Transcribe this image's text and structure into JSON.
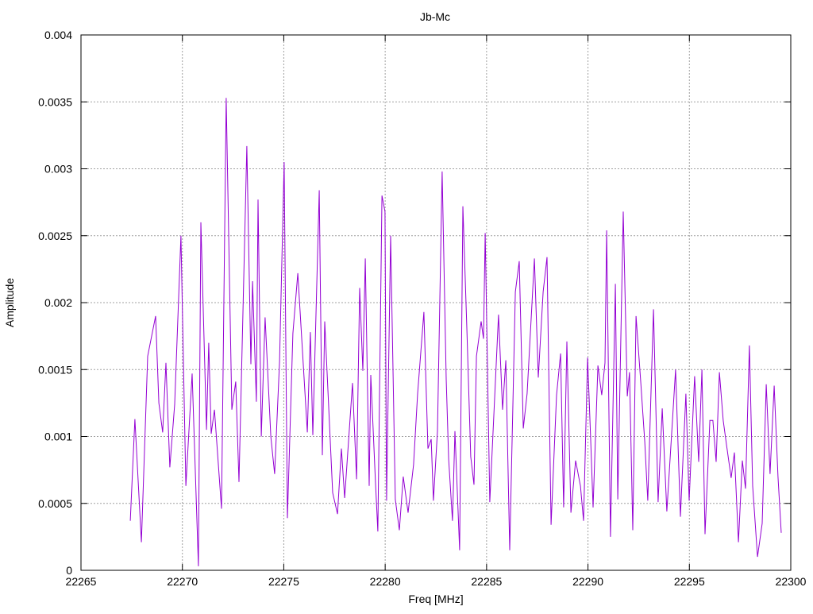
{
  "chart_data": {
    "type": "line",
    "title": "Jb-Mc",
    "xlabel": "Freq [MHz]",
    "ylabel": "Amplitude",
    "xlim": [
      22265,
      22300
    ],
    "ylim": [
      0,
      0.004
    ],
    "xticks": [
      "22265",
      "22270",
      "22275",
      "22280",
      "22285",
      "22290",
      "22295",
      "22300"
    ],
    "yticks": [
      "0",
      "0.0005",
      "0.001",
      "0.0015",
      "0.002",
      "0.0025",
      "0.003",
      "0.0035",
      "0.004"
    ],
    "grid": true,
    "legend": "none",
    "series": [
      {
        "name": "Jb-Mc",
        "color": "#9400d3",
        "x": [
          22267.43,
          22267.66,
          22267.98,
          22268.29,
          22268.68,
          22268.84,
          22269.03,
          22269.19,
          22269.38,
          22269.62,
          22269.93,
          22270.17,
          22270.48,
          22270.79,
          22270.91,
          22271.19,
          22271.3,
          22271.42,
          22271.58,
          22271.93,
          22272.16,
          22272.44,
          22272.63,
          22272.79,
          22273.18,
          22273.38,
          22273.46,
          22273.65,
          22273.73,
          22273.89,
          22274.08,
          22274.36,
          22274.55,
          22274.79,
          22275.02,
          22275.18,
          22275.45,
          22275.69,
          22276.16,
          22276.31,
          22276.43,
          22276.75,
          22276.9,
          22277.02,
          22277.41,
          22277.65,
          22277.84,
          22278.0,
          22278.39,
          22278.59,
          22278.74,
          22278.9,
          22279.02,
          22279.21,
          22279.29,
          22279.52,
          22279.64,
          22279.84,
          22279.99,
          22280.07,
          22280.27,
          22280.5,
          22280.7,
          22280.89,
          22281.13,
          22281.4,
          22281.6,
          22281.91,
          22282.11,
          22282.27,
          22282.38,
          22282.58,
          22282.81,
          22283.01,
          22283.13,
          22283.32,
          22283.44,
          22283.67,
          22283.83,
          22284.03,
          22284.22,
          22284.38,
          22284.5,
          22284.73,
          22284.85,
          22284.93,
          22285.16,
          22285.59,
          22285.79,
          22285.95,
          22286.14,
          22286.42,
          22286.61,
          22286.81,
          22287.0,
          22287.24,
          22287.36,
          22287.55,
          22287.79,
          22287.98,
          22288.18,
          22288.45,
          22288.65,
          22288.8,
          22288.96,
          22289.16,
          22289.39,
          22289.63,
          22289.78,
          22289.98,
          22290.13,
          22290.25,
          22290.49,
          22290.68,
          22290.84,
          22290.92,
          22291.11,
          22291.35,
          22291.47,
          22291.74,
          22291.94,
          22292.05,
          22292.21,
          22292.37,
          22292.6,
          22292.8,
          22292.95,
          22293.23,
          22293.46,
          22293.66,
          22293.89,
          22294.17,
          22294.32,
          22294.56,
          22294.83,
          22294.99,
          22295.26,
          22295.46,
          22295.62,
          22295.77,
          22296.01,
          22296.16,
          22296.32,
          22296.48,
          22296.67,
          22296.83,
          22297.06,
          22297.22,
          22297.42,
          22297.61,
          22297.77,
          22297.96,
          22298.12,
          22298.36,
          22298.59,
          22298.79,
          22298.98,
          22299.18,
          22299.37,
          22299.53
        ],
        "y": [
          0.00037,
          0.00113,
          0.00021,
          0.0016,
          0.0019,
          0.00125,
          0.00103,
          0.00155,
          0.00077,
          0.00124,
          0.0025,
          0.00063,
          0.00147,
          3e-05,
          0.0026,
          0.00105,
          0.0017,
          0.00102,
          0.0012,
          0.00046,
          0.00353,
          0.0012,
          0.00141,
          0.00066,
          0.00317,
          0.00154,
          0.00216,
          0.00126,
          0.00277,
          0.001,
          0.00189,
          0.001,
          0.00072,
          0.00156,
          0.00305,
          0.00039,
          0.00177,
          0.00222,
          0.00103,
          0.00178,
          0.00101,
          0.00284,
          0.00086,
          0.00186,
          0.00058,
          0.00042,
          0.00091,
          0.00054,
          0.0014,
          0.00068,
          0.00211,
          0.00149,
          0.00233,
          0.00063,
          0.00146,
          0.00066,
          0.00029,
          0.0028,
          0.00268,
          0.00052,
          0.0025,
          0.00053,
          0.0003,
          0.0007,
          0.00043,
          0.00079,
          0.00132,
          0.00193,
          0.00091,
          0.00098,
          0.00052,
          0.00104,
          0.00298,
          0.00143,
          0.00083,
          0.00037,
          0.00104,
          0.00015,
          0.00272,
          0.00179,
          0.00085,
          0.00064,
          0.0016,
          0.00186,
          0.00173,
          0.00252,
          0.00051,
          0.00191,
          0.0012,
          0.00157,
          0.00015,
          0.00208,
          0.00231,
          0.00106,
          0.00132,
          0.002,
          0.00233,
          0.00144,
          0.00208,
          0.00234,
          0.00034,
          0.00131,
          0.00162,
          0.00047,
          0.00171,
          0.00043,
          0.00082,
          0.00063,
          0.00037,
          0.00159,
          0.00099,
          0.00047,
          0.00153,
          0.00131,
          0.00155,
          0.00254,
          0.00025,
          0.00214,
          0.00053,
          0.00268,
          0.0013,
          0.00148,
          0.0003,
          0.0019,
          0.00141,
          0.00096,
          0.00052,
          0.00195,
          0.00051,
          0.00121,
          0.00044,
          0.00113,
          0.0015,
          0.0004,
          0.00132,
          0.00052,
          0.00145,
          0.00081,
          0.0015,
          0.00027,
          0.00112,
          0.00112,
          0.00081,
          0.00148,
          0.00112,
          0.00094,
          0.00069,
          0.00088,
          0.00021,
          0.00082,
          0.00061,
          0.00168,
          0.00063,
          0.0001,
          0.00035,
          0.00139,
          0.00072,
          0.00138,
          0.0007,
          0.00028
        ]
      }
    ]
  }
}
